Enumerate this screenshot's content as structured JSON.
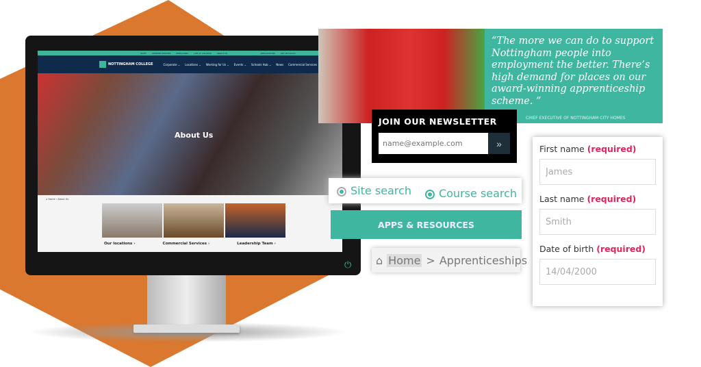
{
  "monitor": {
    "topbar": [
      "STAFF",
      "APPRENTICESHIPS",
      "EMPLOYERS",
      "LIFE AT COLLEGE",
      "ABOUT US",
      "APPLICATIONS",
      "GET IN TOUCH"
    ],
    "logo": "NOTTINGHAM COLLEGE",
    "nav": [
      "Corporate ⌄",
      "Locations ⌄",
      "Working for Us ⌄",
      "Events ⌄",
      "Schools Hub ⌄",
      "News",
      "Commercial Services ⌄"
    ],
    "hero_title": "About Us",
    "breadcrumb": "⌂ Home › About Us",
    "cards": [
      "Our locations ›",
      "Commercial Services ›",
      "Leadership Team ›"
    ]
  },
  "quote": {
    "text": "“The more we can do to support Nottingham people into employment the better. There’s high demand for places on our award-winning apprenticeship scheme. ”",
    "attribution": "CHIEF EXECUTIVE OF NOTTINGHAM CITY HOMES"
  },
  "newsletter": {
    "title": "JOIN OUR NEWSLETTER",
    "placeholder": "name@example.com",
    "submit": "»"
  },
  "search": {
    "options": [
      "Site search",
      "Course search"
    ]
  },
  "apps": "APPS & RESOURCES",
  "breadcrumb": {
    "home": "Home",
    "sep": ">",
    "current": "Apprenticeships"
  },
  "form": {
    "fields": [
      {
        "label": "First name",
        "req": "(required)",
        "value": "James"
      },
      {
        "label": "Last name",
        "req": "(required)",
        "value": "Smith"
      },
      {
        "label": "Date of birth",
        "req": "(required)",
        "value": "14/04/2000"
      }
    ]
  },
  "colors": {
    "teal": "#3fb6a0",
    "orange": "#d9782e",
    "navy": "#0f2a4a"
  }
}
